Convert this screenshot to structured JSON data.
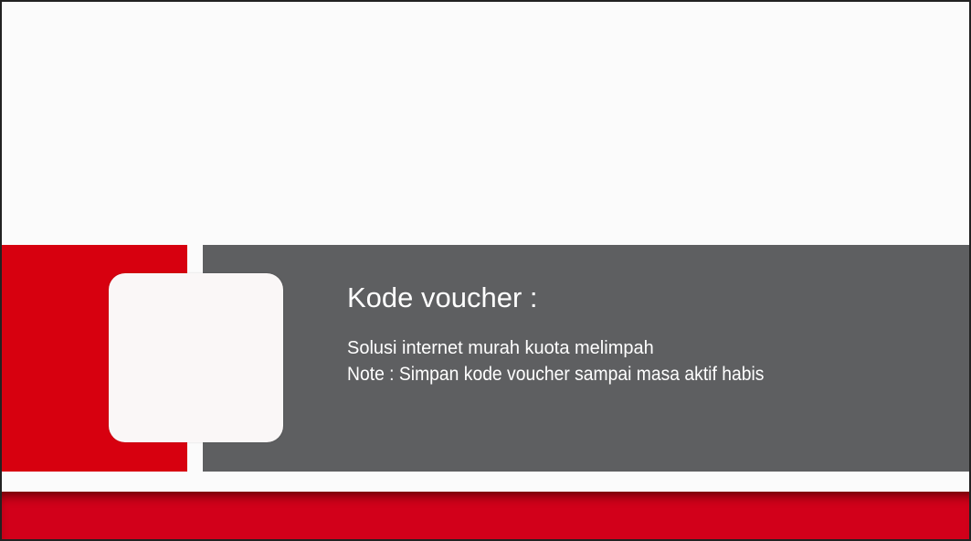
{
  "voucher": {
    "title": "Kode voucher :",
    "tagline": "Solusi internet murah kuota melimpah",
    "note": "Note : Simpan kode voucher sampai masa aktif habis"
  },
  "colors": {
    "brand_red": "#d7000f",
    "band_gray": "#5e5f61",
    "background": "#fbfbfb",
    "text_on_band": "#ffffff"
  }
}
